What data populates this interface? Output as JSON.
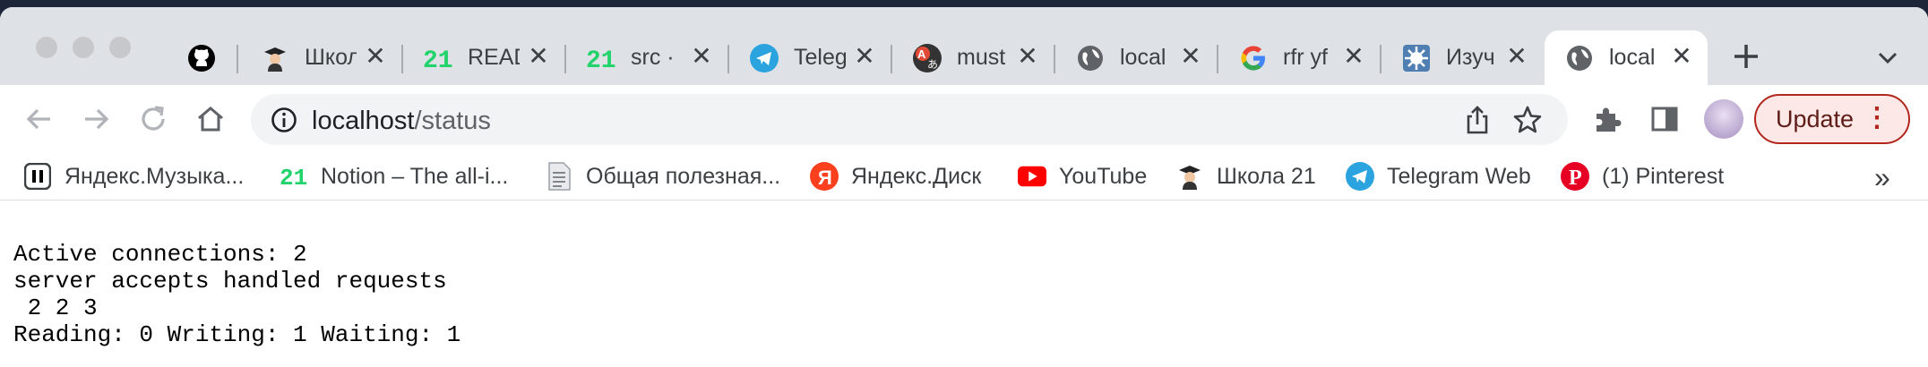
{
  "tabs": [
    {
      "title": "",
      "favicon": "github-icon"
    },
    {
      "title": "Школ",
      "favicon": "school21-icon"
    },
    {
      "title": "READ",
      "favicon": "21-icon"
    },
    {
      "title": "src ·",
      "favicon": "21-icon"
    },
    {
      "title": "Teleg",
      "favicon": "telegram-icon"
    },
    {
      "title": "must",
      "favicon": "translate-icon"
    },
    {
      "title": "local",
      "favicon": "globe-icon"
    },
    {
      "title": "rfr yf",
      "favicon": "google-icon"
    },
    {
      "title": "Изуч",
      "favicon": "virus-icon"
    },
    {
      "title": "local",
      "favicon": "globe-icon",
      "active": true
    }
  ],
  "omnibox": {
    "host": "localhost",
    "path": "/status"
  },
  "toolbar": {
    "update_label": "Update",
    "menu_label": "⋮"
  },
  "bookmarks": [
    {
      "label": "Яндекс.Музыка...",
      "icon": "pause-icon"
    },
    {
      "label": "Notion – The all-i...",
      "icon": "21-icon"
    },
    {
      "label": "Общая полезная...",
      "icon": "document-icon"
    },
    {
      "label": "Яндекс.Диск",
      "icon": "yandex-icon"
    },
    {
      "label": "YouTube",
      "icon": "youtube-icon"
    },
    {
      "label": "Школа 21",
      "icon": "school21-icon"
    },
    {
      "label": "Telegram Web",
      "icon": "telegram-icon"
    },
    {
      "label": "(1) Pinterest",
      "icon": "pinterest-icon"
    }
  ],
  "more_label": "»",
  "status": {
    "line1": "Active connections: 2",
    "line2": "server accepts handled requests",
    "line3": " 2 2 3",
    "line4": "Reading: 0 Writing: 1 Waiting: 1"
  },
  "colors": {
    "tabstrip": "#dee1e6",
    "update_border": "#b3261e",
    "telegram": "#2aa3df",
    "youtube": "#ff0000",
    "pinterest": "#e60023",
    "yandex": "#fc3f1d",
    "notion21": "#22d36b"
  }
}
